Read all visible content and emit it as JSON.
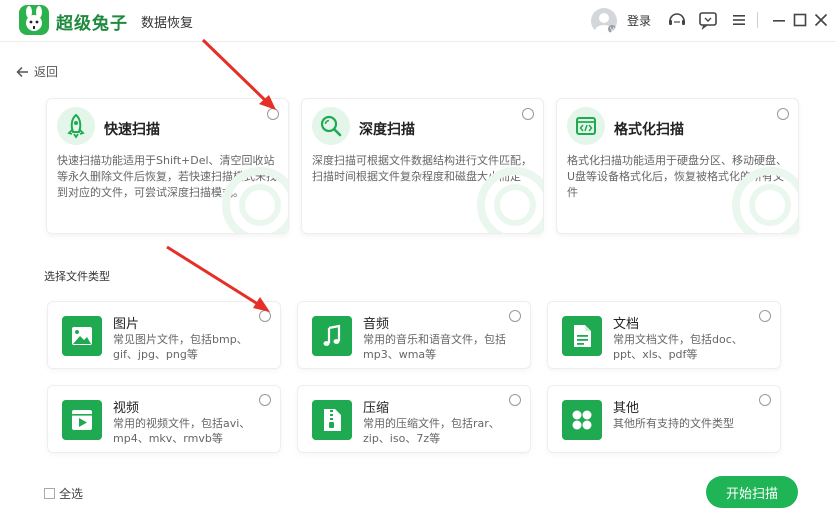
{
  "header": {
    "brand": "超级兔子",
    "subtitle": "数据恢复",
    "login": "登录"
  },
  "nav": {
    "back": "返回"
  },
  "scan_modes": [
    {
      "title": "快速扫描",
      "description": "快速扫描功能适用于Shift+Del、清空回收站等永久删除文件后恢复，若快速扫描模式未找到对应的文件，可尝试深度扫描模式。",
      "icon": "rocket-icon"
    },
    {
      "title": "深度扫描",
      "description": "深度扫描可根据文件数据结构进行文件匹配，扫描时间根据文件复杂程度和磁盘大小而定",
      "icon": "magnifier-icon"
    },
    {
      "title": "格式化扫描",
      "description": "格式化扫描功能适用于硬盘分区、移动硬盘、U盘等设备格式化后，恢复被格式化的所有文件",
      "icon": "format-code-icon"
    }
  ],
  "file_types_label": "选择文件类型",
  "file_types": [
    {
      "name": "图片",
      "description": "常见图片文件，包括bmp、gif、jpg、png等",
      "icon": "image-icon"
    },
    {
      "name": "音频",
      "description": "常用的音乐和语音文件，包括mp3、wma等",
      "icon": "music-note-icon"
    },
    {
      "name": "文档",
      "description": "常用文档文件，包括doc、ppt、xls、pdf等",
      "icon": "document-icon"
    },
    {
      "name": "视频",
      "description": "常用的视频文件，包括avi、mp4、mkv、rmvb等",
      "icon": "video-icon"
    },
    {
      "name": "压缩",
      "description": "常用的压缩文件，包括rar、zip、iso、7z等",
      "icon": "zip-icon"
    },
    {
      "name": "其他",
      "description": "其他所有支持的文件类型",
      "icon": "grid-icon"
    }
  ],
  "footer": {
    "select_all": "全选",
    "start": "开始扫描"
  },
  "colors": {
    "accent": "#1fb455",
    "icon_bg": "#1faa52",
    "annotation_arrow": "#e53027"
  }
}
